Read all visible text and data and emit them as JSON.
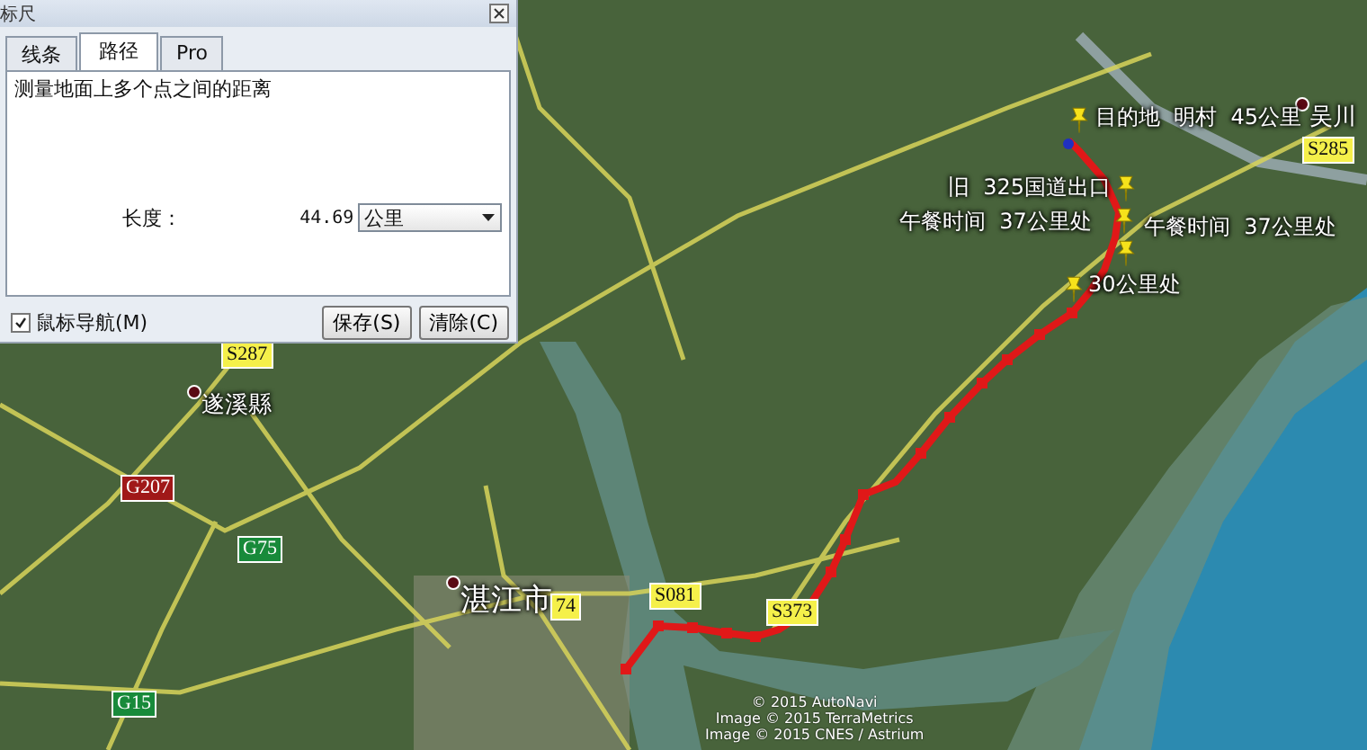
{
  "dialog": {
    "title": "标尺",
    "tabs": [
      {
        "label": "线条",
        "selected": false
      },
      {
        "label": "路径",
        "selected": true
      },
      {
        "label": "Pro",
        "selected": false
      }
    ],
    "description": "测量地面上多个点之间的距离",
    "length_label": "长度：",
    "length_value": "44.69",
    "unit": "公里",
    "mouse_nav": {
      "label": "鼠标导航(M)",
      "checked": true
    },
    "buttons": [
      "保存(S)",
      "清除(C)"
    ]
  },
  "map": {
    "places": [
      {
        "name": "遂溪縣",
        "kind": "county"
      },
      {
        "name": "湛江市",
        "kind": "city"
      },
      {
        "name": "吴川",
        "kind": "county"
      }
    ],
    "roads": [
      {
        "label": "S287",
        "kind": "provincial"
      },
      {
        "label": "G207",
        "kind": "national"
      },
      {
        "label": "G75",
        "kind": "expressway"
      },
      {
        "label": "G15",
        "kind": "expressway"
      },
      {
        "label": "74",
        "kind": "provincial"
      },
      {
        "label": "S081",
        "kind": "provincial"
      },
      {
        "label": "S373",
        "kind": "provincial"
      },
      {
        "label": "S285",
        "kind": "provincial"
      }
    ],
    "placemarks": [
      {
        "label": "目的地  明村  45公里"
      },
      {
        "label": "旧  325国道出口"
      },
      {
        "label": "午餐时间  37公里处"
      },
      {
        "label": "午餐时间  37公里处"
      },
      {
        "label": "30公里处"
      }
    ],
    "attribution": [
      "© 2015 AutoNavi",
      "Image © 2015 TerraMetrics",
      "Image © 2015 CNES / Astrium"
    ]
  }
}
